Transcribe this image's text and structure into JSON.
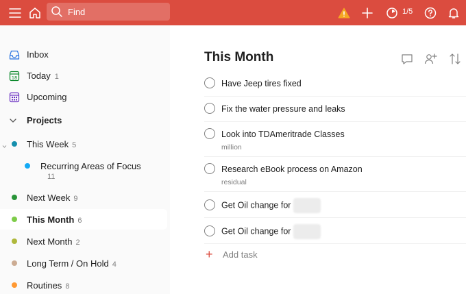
{
  "topbar": {
    "background": "#db4c3f",
    "search_placeholder": "Find",
    "karma_progress": "1/5",
    "icons": [
      "menu-icon",
      "home-icon",
      "search-icon",
      "warning-icon",
      "plus-icon",
      "productivity-icon",
      "help-icon",
      "bell-icon"
    ]
  },
  "sidebar": {
    "nav": [
      {
        "label": "Inbox",
        "count": "",
        "icon": "inbox-icon"
      },
      {
        "label": "Today",
        "count": "1",
        "icon": "calendar-today-icon"
      },
      {
        "label": "Upcoming",
        "count": "",
        "icon": "calendar-grid-icon"
      }
    ],
    "projects_header": "Projects",
    "projects": [
      {
        "label": "This Week",
        "count": "5",
        "color": "#158fad"
      },
      {
        "label": "Recurring Areas of Focus",
        "count": "11",
        "color": "#14aaf5"
      },
      {
        "label": "Next Week",
        "count": "9",
        "color": "#299438"
      },
      {
        "label": "This Month",
        "count": "6",
        "color": "#7ecc49"
      },
      {
        "label": "Next Month",
        "count": "2",
        "color": "#afb83b"
      },
      {
        "label": "Long Term / On Hold",
        "count": "4",
        "color": "#ccac93"
      },
      {
        "label": "Routines",
        "count": "8",
        "color": "#ff9933"
      }
    ]
  },
  "main": {
    "title": "This Month",
    "tasks": [
      {
        "title": "Have Jeep tires fixed",
        "note": ""
      },
      {
        "title": "Fix the water pressure and leaks",
        "note": ""
      },
      {
        "title": "Look into TDAmeritrade Classes",
        "note": "million"
      },
      {
        "title": "Research eBook process on Amazon",
        "note": "residual"
      },
      {
        "title": "Get Oil change for",
        "note": ""
      },
      {
        "title": "Get Oil change for",
        "note": ""
      }
    ],
    "add_task_label": "Add task",
    "accent": "#db4c3f"
  }
}
